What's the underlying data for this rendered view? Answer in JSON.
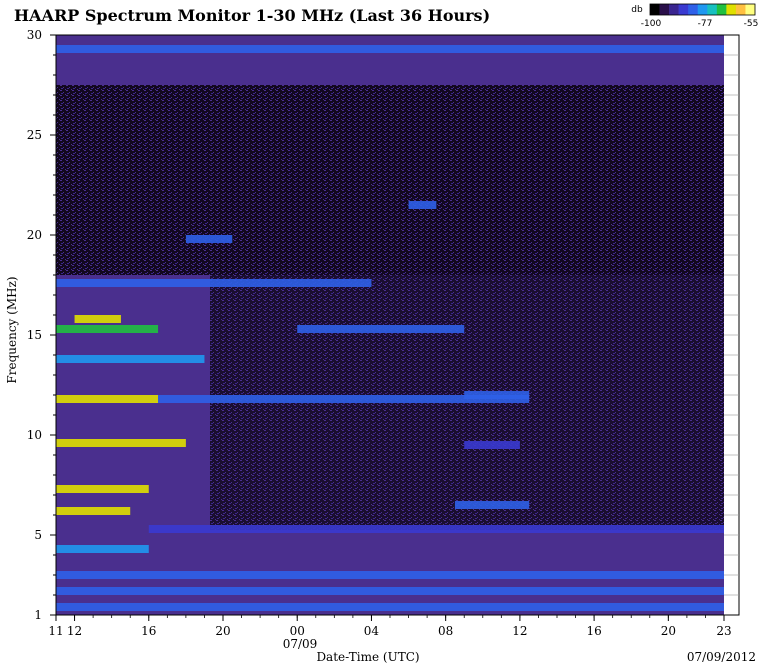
{
  "chart_data": {
    "type": "heatmap",
    "title": "HAARP Spectrum Monitor 1-30 MHz (Last 36 Hours)",
    "xlabel": "Date-Time (UTC)",
    "ylabel": "Frequency (MHz)",
    "date_stamp": "07/09/2012",
    "x_date_label": "07/09",
    "x_tick_labels": [
      "11",
      "12",
      "16",
      "20",
      "00",
      "04",
      "08",
      "12",
      "16",
      "20",
      "23"
    ],
    "x_tick_hours": [
      11,
      12,
      16,
      20,
      24,
      28,
      32,
      36,
      40,
      44,
      47
    ],
    "xlim_hours": [
      11,
      47
    ],
    "y_tick_labels": [
      "1",
      "5",
      "10",
      "15",
      "20",
      "25",
      "30"
    ],
    "y_ticks": [
      1,
      5,
      10,
      15,
      20,
      25,
      30
    ],
    "ylim": [
      1,
      30
    ],
    "legend": {
      "unit": "db",
      "labels": [
        "-100",
        "-77",
        "-55"
      ],
      "range": [
        -100,
        -55
      ],
      "colors": [
        "#000000",
        "#2a0f4a",
        "#3a2590",
        "#3a3ad0",
        "#2f60e8",
        "#1f98f0",
        "#18c0c0",
        "#20c040",
        "#e0e000",
        "#ffc040",
        "#ffff80"
      ]
    },
    "background_color": "#4a2f8e",
    "bands": [
      {
        "f": 29.3,
        "h0": 11.0,
        "h1": 47.0,
        "db": -82
      },
      {
        "f": 17.6,
        "h0": 11.0,
        "h1": 28.0,
        "db": -80
      },
      {
        "f": 15.3,
        "h0": 11.0,
        "h1": 16.5,
        "db": -70
      },
      {
        "f": 15.8,
        "h0": 12.0,
        "h1": 14.5,
        "db": -65
      },
      {
        "f": 15.3,
        "h0": 24.0,
        "h1": 33.0,
        "db": -80
      },
      {
        "f": 13.8,
        "h0": 11.0,
        "h1": 19.0,
        "db": -79
      },
      {
        "f": 11.8,
        "h0": 11.0,
        "h1": 16.5,
        "db": -62
      },
      {
        "f": 11.8,
        "h0": 16.5,
        "h1": 36.5,
        "db": -84
      },
      {
        "f": 9.6,
        "h0": 11.0,
        "h1": 18.0,
        "db": -66
      },
      {
        "f": 7.3,
        "h0": 11.0,
        "h1": 16.0,
        "db": -66
      },
      {
        "f": 6.2,
        "h0": 11.0,
        "h1": 15.0,
        "db": -64
      },
      {
        "f": 5.3,
        "h0": 16.0,
        "h1": 47.0,
        "db": -86
      },
      {
        "f": 4.3,
        "h0": 11.0,
        "h1": 16.0,
        "db": -78
      },
      {
        "f": 3.0,
        "h0": 11.0,
        "h1": 47.0,
        "db": -80
      },
      {
        "f": 2.2,
        "h0": 11.0,
        "h1": 47.0,
        "db": -82
      },
      {
        "f": 1.4,
        "h0": 11.0,
        "h1": 47.0,
        "db": -84
      },
      {
        "f": 21.5,
        "h0": 30.0,
        "h1": 31.5,
        "db": -80
      },
      {
        "f": 19.8,
        "h0": 18.0,
        "h1": 20.5,
        "db": -82
      },
      {
        "f": 12.0,
        "h0": 33.0,
        "h1": 36.5,
        "db": -80
      },
      {
        "f": 6.5,
        "h0": 32.5,
        "h1": 36.5,
        "db": -84
      },
      {
        "f": 9.5,
        "h0": 33.0,
        "h1": 36.0,
        "db": -86
      }
    ]
  }
}
